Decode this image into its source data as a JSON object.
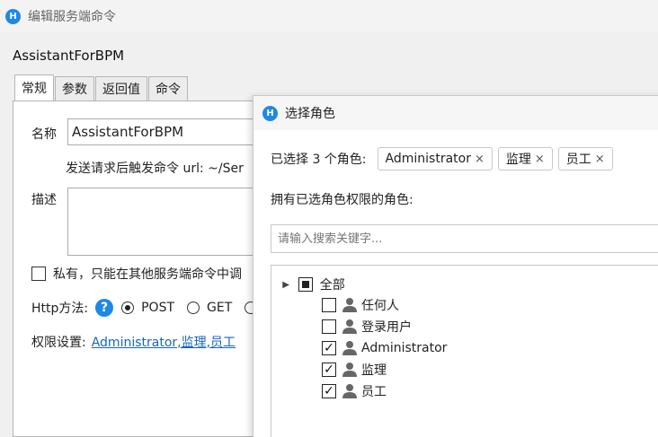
{
  "main": {
    "title": "编辑服务端命令",
    "icon_letter": "H",
    "command_name": "AssistantForBPM",
    "tabs": [
      "常规",
      "参数",
      "返回值",
      "命令"
    ],
    "name_label": "名称",
    "name_value": "AssistantForBPM",
    "url_hint": "发送请求后触发命令 url: ~/Ser",
    "desc_label": "描述",
    "private_label": "私有，只能在其他服务端命令中调",
    "http_label": "Http方法:",
    "help_glyph": "?",
    "method_post": "POST",
    "method_get": "GET",
    "perm_label": "权限设置:",
    "perm_value": "Administrator,监理,员工"
  },
  "dialog": {
    "title": "选择角色",
    "icon_letter": "H",
    "selected_label": "已选择 3 个角色:",
    "chips": [
      "Administrator",
      "监理",
      "员工"
    ],
    "chip_close": "×",
    "roles_label": "拥有已选角色权限的角色:",
    "search_placeholder": "请输入搜索关键字...",
    "tree_root": "全部",
    "tree_items": [
      {
        "label": "任何人",
        "checked": false
      },
      {
        "label": "登录用户",
        "checked": false
      },
      {
        "label": "Administrator",
        "checked": true
      },
      {
        "label": "监理",
        "checked": true
      },
      {
        "label": "员工",
        "checked": true
      }
    ],
    "check_glyph": "✓",
    "expander_glyph": "▲"
  },
  "colors": {
    "accent": "#1e88e5",
    "link": "#1565c0"
  }
}
